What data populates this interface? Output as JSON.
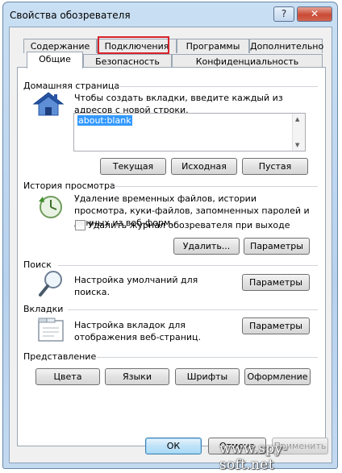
{
  "window": {
    "title": "Свойства обозревателя",
    "help": "?",
    "close": "✕"
  },
  "tabs": [
    {
      "label": "Содержание"
    },
    {
      "label": "Подключения"
    },
    {
      "label": "Программы"
    },
    {
      "label": "Дополнительно"
    },
    {
      "label": "Общие"
    },
    {
      "label": "Безопасность"
    },
    {
      "label": "Конфиденциальность"
    }
  ],
  "home_page": {
    "title": "Домашняя страница",
    "description": "Чтобы создать вкладки, введите каждый из адресов с новой строки.",
    "url": "about:blank",
    "buttons": {
      "current": "Текущая",
      "original": "Исходная",
      "blank": "Пустая"
    }
  },
  "history": {
    "title": "История просмотра",
    "description": "Удаление временных файлов, истории просмотра, куки-файлов, запомненных паролей и данных из веб-форм.",
    "checkbox_label": "Удалить журнал обозревателя при выходе",
    "checkbox_checked": false,
    "buttons": {
      "delete": "Удалить...",
      "settings": "Параметры"
    }
  },
  "search": {
    "title": "Поиск",
    "description": "Настройка умолчаний для поиска.",
    "settings": "Параметры"
  },
  "tabs_section": {
    "title": "Вкладки",
    "description": "Настройка вкладок для отображения веб-страниц.",
    "settings": "Параметры"
  },
  "appearance": {
    "title": "Представление",
    "buttons": {
      "colors": "Цвета",
      "languages": "Языки",
      "fonts": "Шрифты",
      "accessibility": "Оформление"
    }
  },
  "footer": {
    "ok": "ОК",
    "cancel": "Отмена",
    "apply": "Применить"
  },
  "watermark": "www.spy-soft.net",
  "colors": {
    "highlight": "#d8222a",
    "selection": "#3399ff",
    "close_button": "#c94a35"
  }
}
